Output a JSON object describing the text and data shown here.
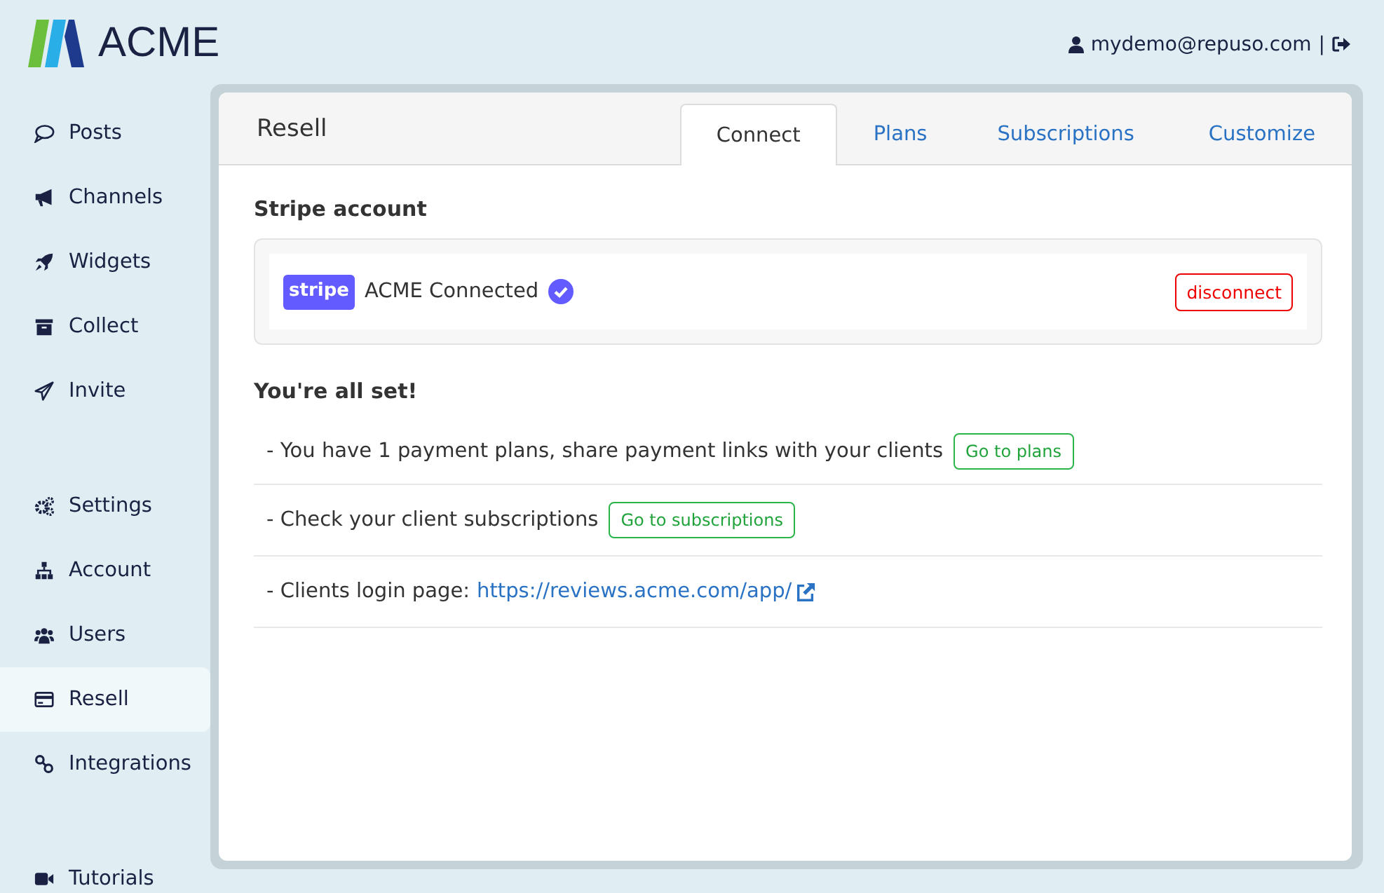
{
  "brand": {
    "name": "ACME"
  },
  "user": {
    "email": "mydemo@repuso.com",
    "separator": "|"
  },
  "sidebar": {
    "groups": [
      [
        {
          "label": "Posts",
          "selected": false
        },
        {
          "label": "Channels",
          "selected": false
        },
        {
          "label": "Widgets",
          "selected": false
        },
        {
          "label": "Collect",
          "selected": false
        },
        {
          "label": "Invite",
          "selected": false
        }
      ],
      [
        {
          "label": "Settings",
          "selected": false
        },
        {
          "label": "Account",
          "selected": false
        },
        {
          "label": "Users",
          "selected": false
        },
        {
          "label": "Resell",
          "selected": true
        },
        {
          "label": "Integrations",
          "selected": false
        }
      ],
      [
        {
          "label": "Tutorials",
          "selected": false
        }
      ]
    ]
  },
  "panel": {
    "title": "Resell",
    "tabs": [
      {
        "label": "Connect",
        "selected": true
      },
      {
        "label": "Plans",
        "selected": false
      },
      {
        "label": "Subscriptions",
        "selected": false
      },
      {
        "label": "Customize",
        "selected": false
      }
    ],
    "stripe": {
      "heading": "Stripe account",
      "logo": "stripe",
      "account": "ACME Connected",
      "verified": true,
      "button": "disconnect"
    },
    "status": {
      "heading": "You're all set!",
      "items": [
        {
          "kind": "button",
          "text": "- You have 1 payment plans, share payment links with your clients",
          "action": "Go to plans"
        },
        {
          "kind": "button",
          "text": "- Check your client subscriptions",
          "action": "Go to subscriptions"
        },
        {
          "kind": "link",
          "text": "- Clients login page:",
          "action": "https://reviews.acme.com/app/"
        }
      ]
    }
  }
}
